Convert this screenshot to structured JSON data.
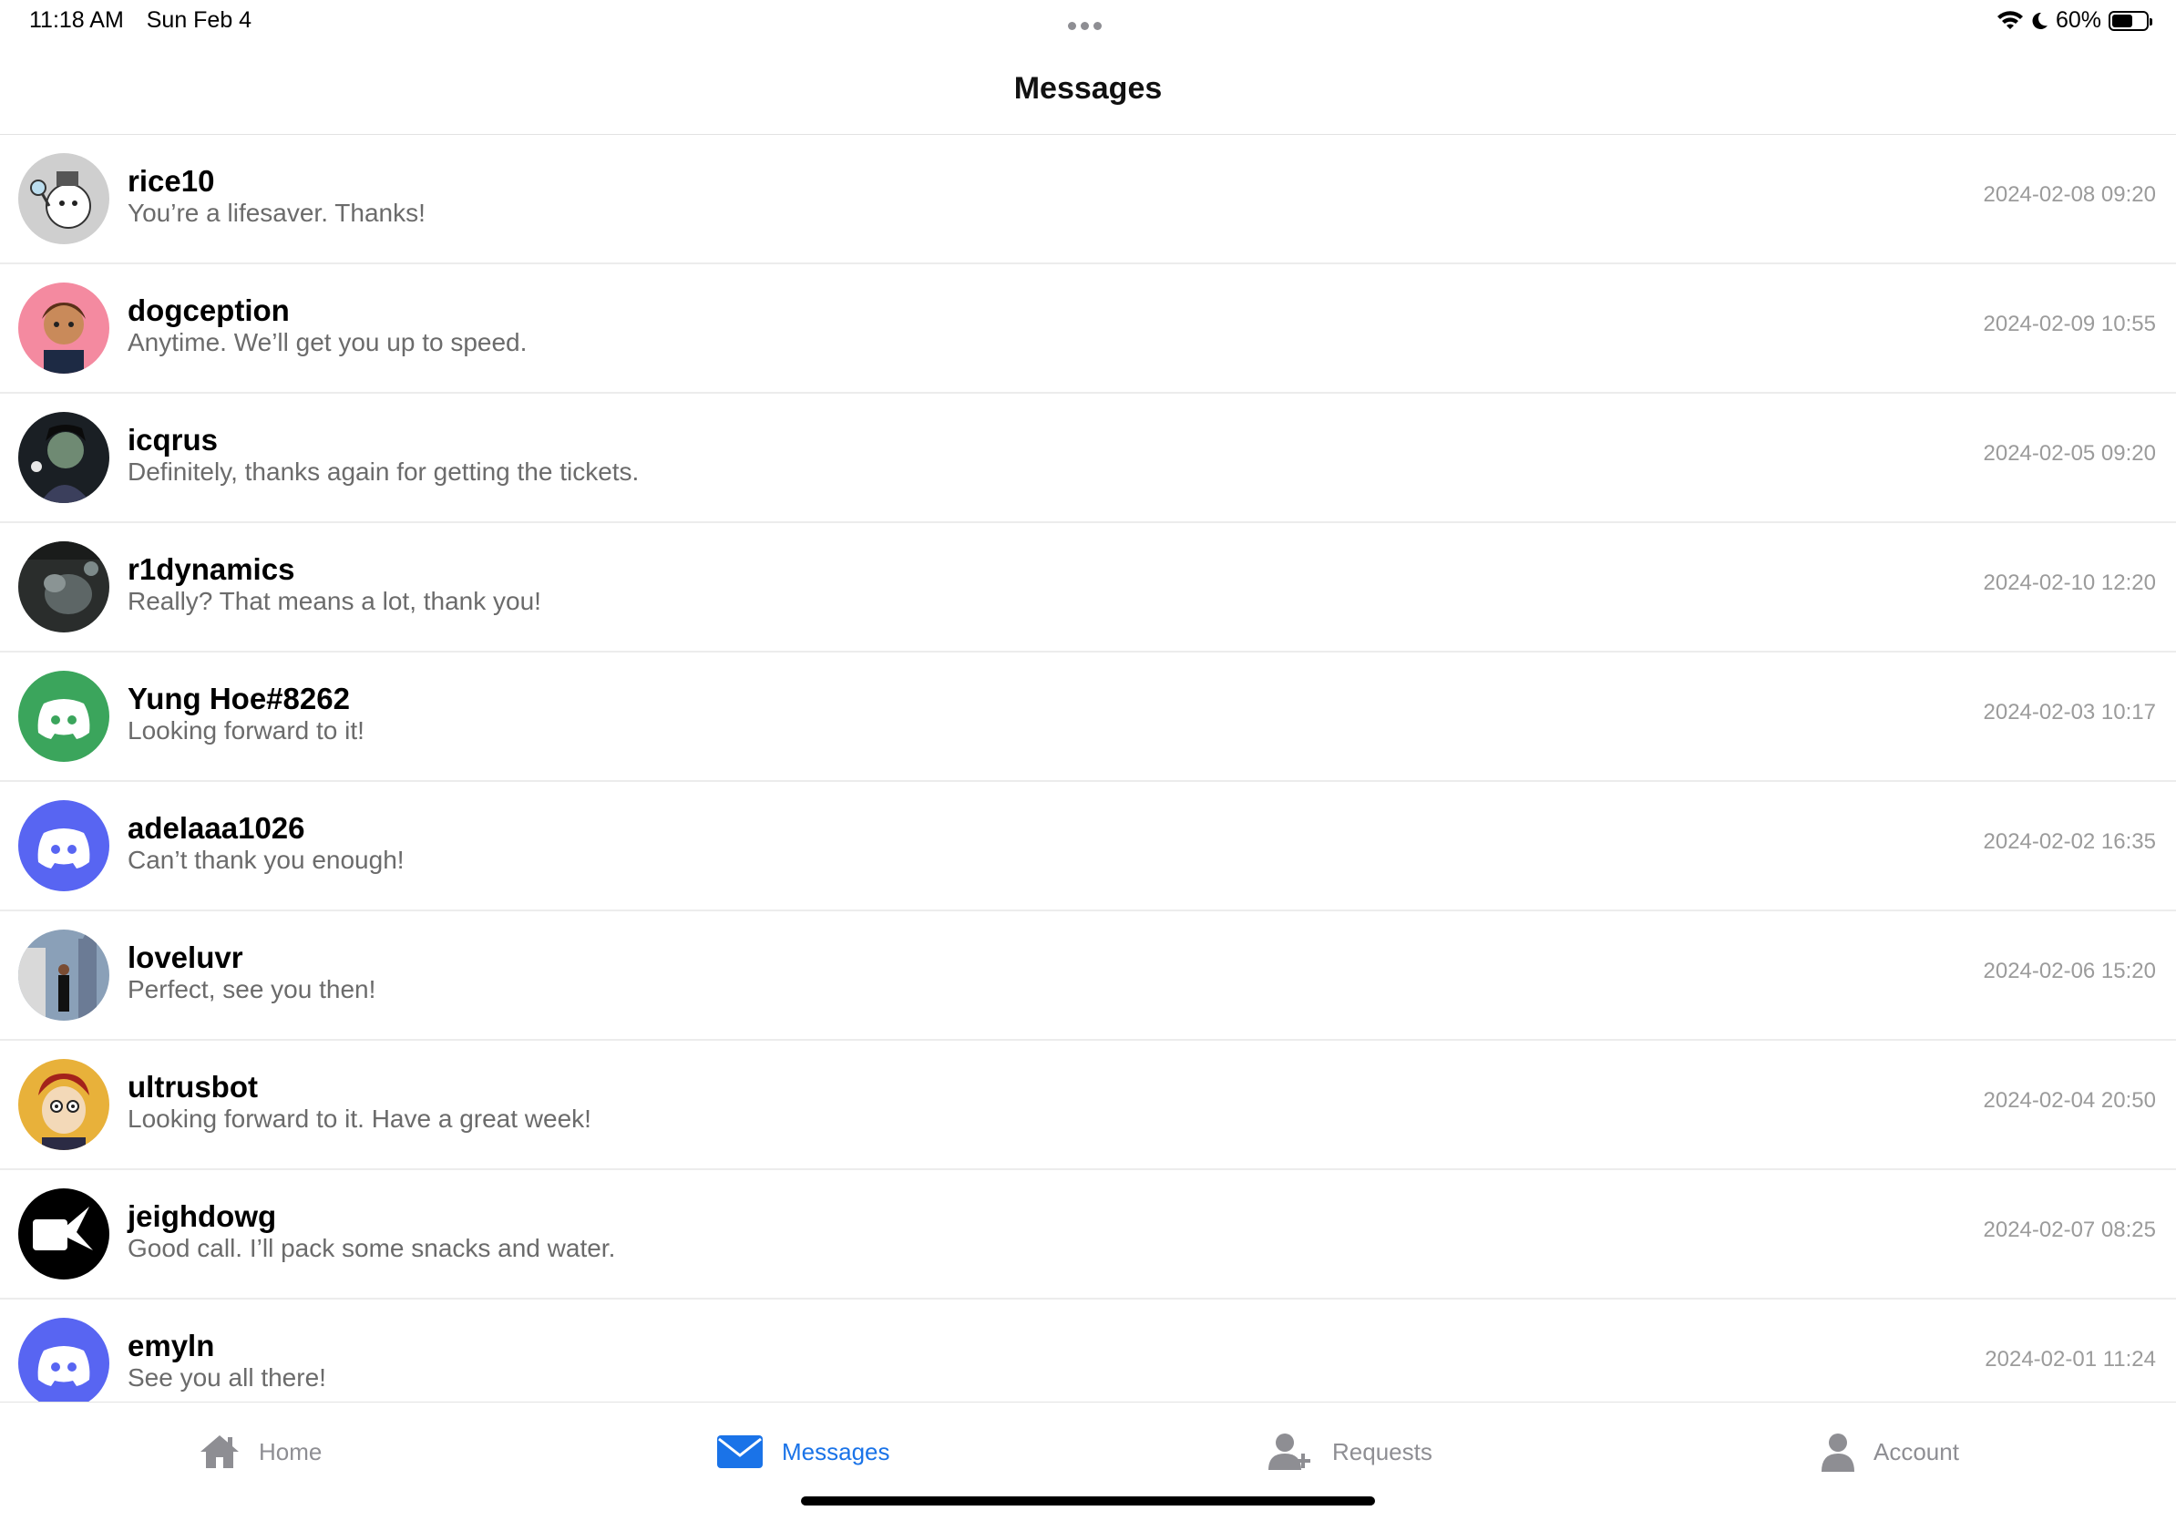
{
  "status": {
    "time": "11:18 AM",
    "date": "Sun Feb 4",
    "battery": "60%",
    "battery_level": 0.6,
    "icons": [
      "wifi-icon",
      "moon-icon",
      "battery-icon"
    ]
  },
  "header": {
    "title": "Messages"
  },
  "conversations": [
    {
      "name": "rice10",
      "preview": "You’re a lifesaver. Thanks!",
      "time": "2024-02-08 09:20",
      "avatar": "mascot-avatar"
    },
    {
      "name": "dogception",
      "preview": "Anytime. We’ll get you up to speed.",
      "time": "2024-02-09 10:55",
      "avatar": "cartoon-person-avatar"
    },
    {
      "name": "icqrus",
      "preview": "Definitely, thanks again for getting the tickets.",
      "time": "2024-02-05 09:20",
      "avatar": "dark-character-avatar"
    },
    {
      "name": "r1dynamics",
      "preview": "Really? That means a lot, thank you!",
      "time": "2024-02-10 12:20",
      "avatar": "photo-avatar"
    },
    {
      "name": "Yung Hoe#8262",
      "preview": "Looking forward to it!",
      "time": "2024-02-03 10:17",
      "avatar": "discord-avatar-green"
    },
    {
      "name": "adelaaa1026",
      "preview": "Can’t thank you enough!",
      "time": "2024-02-02 16:35",
      "avatar": "discord-avatar-blurple"
    },
    {
      "name": "loveluvr",
      "preview": "Perfect, see you then!",
      "time": "2024-02-06 15:20",
      "avatar": "city-photo-avatar"
    },
    {
      "name": "ultrusbot",
      "preview": "Looking forward to it. Have a great week!",
      "time": "2024-02-04 20:50",
      "avatar": "cartoon-boy-avatar"
    },
    {
      "name": "jeighdowg",
      "preview": "Good call. I’ll pack some snacks and water.",
      "time": "2024-02-07 08:25",
      "avatar": "keyboard-logo-avatar"
    },
    {
      "name": "emyln",
      "preview": "See you all there!",
      "time": "2024-02-01 11:24",
      "avatar": "discord-avatar-blurple"
    }
  ],
  "tabbar": {
    "home": "Home",
    "messages": "Messages",
    "requests": "Requests",
    "account": "Account"
  },
  "colors": {
    "accent": "#1a73e8",
    "inactive": "#8e8e93",
    "discord_green": "#3ba55c",
    "discord_blurple": "#5865f2"
  }
}
